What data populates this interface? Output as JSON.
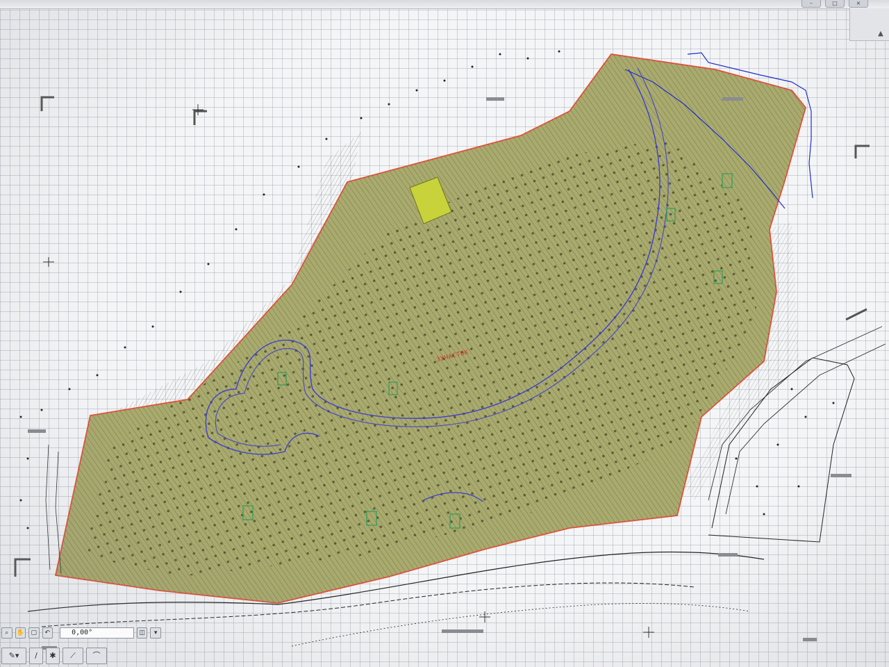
{
  "window": {
    "controls": [
      "–",
      "□",
      "×"
    ]
  },
  "drawing": {
    "plot_label": "3УЧАСТОК",
    "colors": {
      "site_fill": "#a9aa6e",
      "boundary": "#e0533a",
      "road": "#3b3fd0",
      "stream": "#1f2fc9",
      "hatch": "#4e4a22",
      "highlight_block": "#c8d23a",
      "grid": "#a0a5af"
    }
  },
  "status_bar": {
    "nav_icons": [
      "zoom-icon",
      "pan-icon",
      "fit-icon",
      "prev-icon"
    ],
    "angle_value": "0,00°"
  },
  "toolbar": {
    "tools": [
      "select-arrow-icon",
      "pen-icon",
      "star-icon",
      "line-icon",
      "arc-icon"
    ]
  }
}
